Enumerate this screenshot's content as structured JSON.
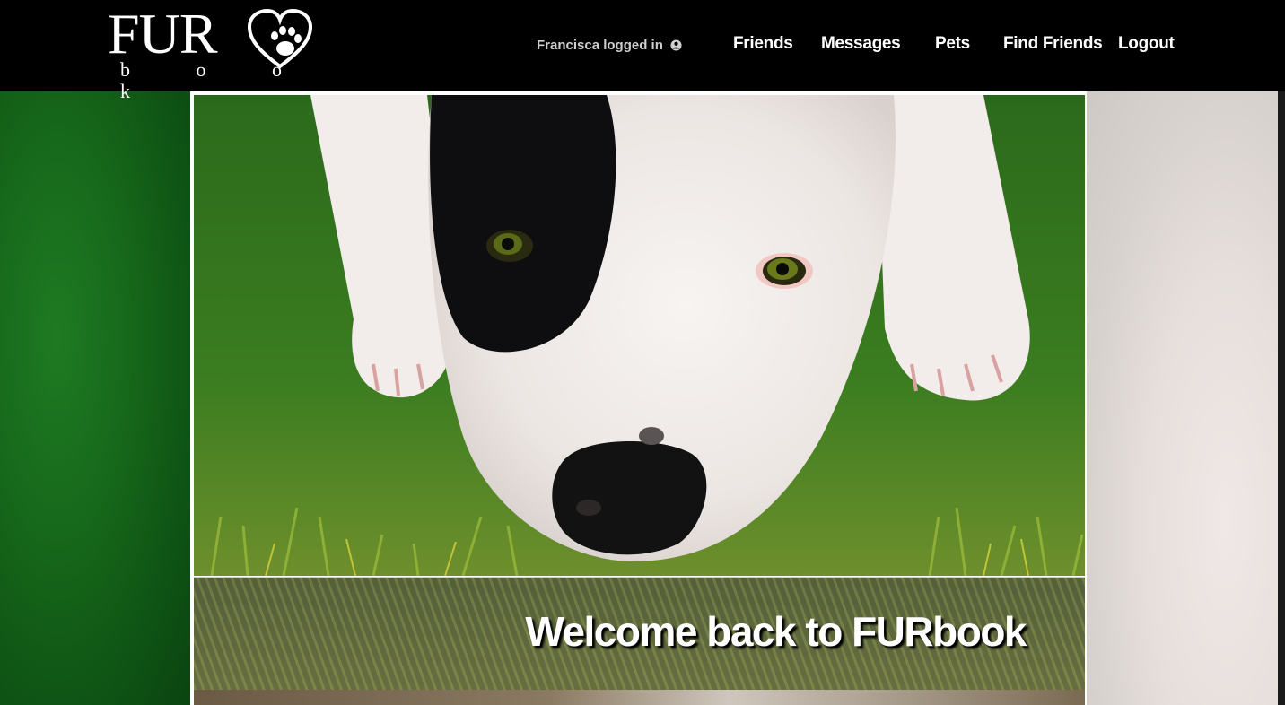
{
  "header": {
    "logo": {
      "title": "FUR",
      "subtitle": "b o o k"
    },
    "user_status": "Francisca logged in",
    "nav": [
      {
        "label": "Friends"
      },
      {
        "label": "Messages"
      },
      {
        "label": "Pets"
      },
      {
        "label": "Find Friends"
      },
      {
        "label": "Logout"
      }
    ]
  },
  "main": {
    "welcome_text": "Welcome back to FURbook"
  },
  "colors": {
    "header_bg": "#000000",
    "text": "#ffffff",
    "user_status_text": "#cfcfcf"
  },
  "icons": [
    "paw-heart-icon",
    "user-icon"
  ]
}
